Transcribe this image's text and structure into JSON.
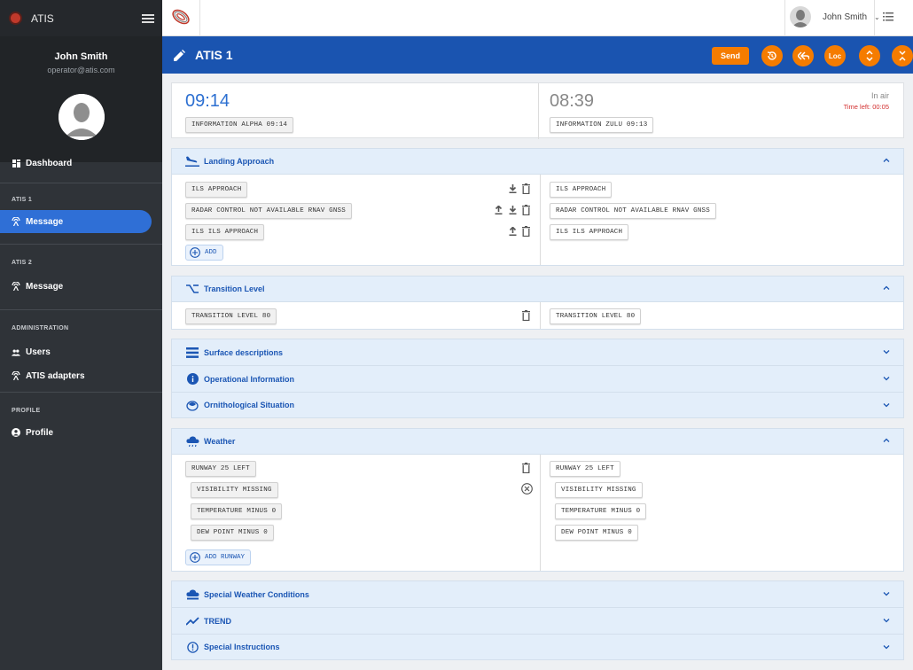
{
  "app": {
    "name": "ATIS"
  },
  "user": {
    "name": "John Smith",
    "email": "operator@atis.com"
  },
  "sidebar": {
    "dashboard": "Dashboard",
    "sections": [
      {
        "label": "ATIS 1",
        "items": [
          {
            "label": "Message",
            "active": true
          }
        ]
      },
      {
        "label": "ATIS 2",
        "items": [
          {
            "label": "Message",
            "active": false
          }
        ]
      },
      {
        "label": "ADMINISTRATION",
        "items": [
          {
            "label": "Users"
          },
          {
            "label": "ATIS adapters"
          }
        ]
      },
      {
        "label": "PROFILE",
        "items": [
          {
            "label": "Profile"
          }
        ]
      }
    ]
  },
  "topbar": {
    "user_name": "John Smith"
  },
  "titlebar": {
    "title": "ATIS 1",
    "send_label": "Send",
    "loc_label": "Loc"
  },
  "header_card": {
    "left": {
      "time": "09:14",
      "info": "INFORMATION ALPHA 09:14"
    },
    "right": {
      "time": "08:39",
      "info": "INFORMATION ZULU 09:13",
      "status": "In air",
      "time_left": "Time left: 00:05"
    }
  },
  "landing": {
    "title": "Landing Approach",
    "items": [
      "ILS APPROACH",
      "RADAR CONTROL NOT AVAILABLE RNAV GNSS",
      "ILS ILS APPROACH"
    ],
    "preview": [
      "ILS APPROACH",
      "RADAR CONTROL NOT AVAILABLE RNAV GNSS",
      "ILS ILS APPROACH"
    ],
    "add_label": "ADD"
  },
  "transition": {
    "title": "Transition Level",
    "item": "TRANSITION LEVEL 80",
    "preview": "TRANSITION LEVEL 80"
  },
  "collapsed_a": [
    "Surface descriptions",
    "Operational Information",
    "Ornithological Situation"
  ],
  "weather": {
    "title": "Weather",
    "runway": "RUNWAY 25 LEFT",
    "items": [
      "VISIBILITY MISSING",
      "TEMPERATURE MINUS 0",
      "DEW POINT MINUS 0"
    ],
    "preview_runway": "RUNWAY 25 LEFT",
    "preview": [
      "VISIBILITY MISSING",
      "TEMPERATURE MINUS 0",
      "DEW POINT MINUS 0"
    ],
    "add_label": "ADD RUNWAY"
  },
  "collapsed_b": [
    "Special Weather Conditions",
    "TREND",
    "Special Instructions"
  ],
  "colors": {
    "accent": "#1a54b0",
    "orange": "#f57c00",
    "sidebar": "#2f3338",
    "active": "#2f6fd6"
  }
}
